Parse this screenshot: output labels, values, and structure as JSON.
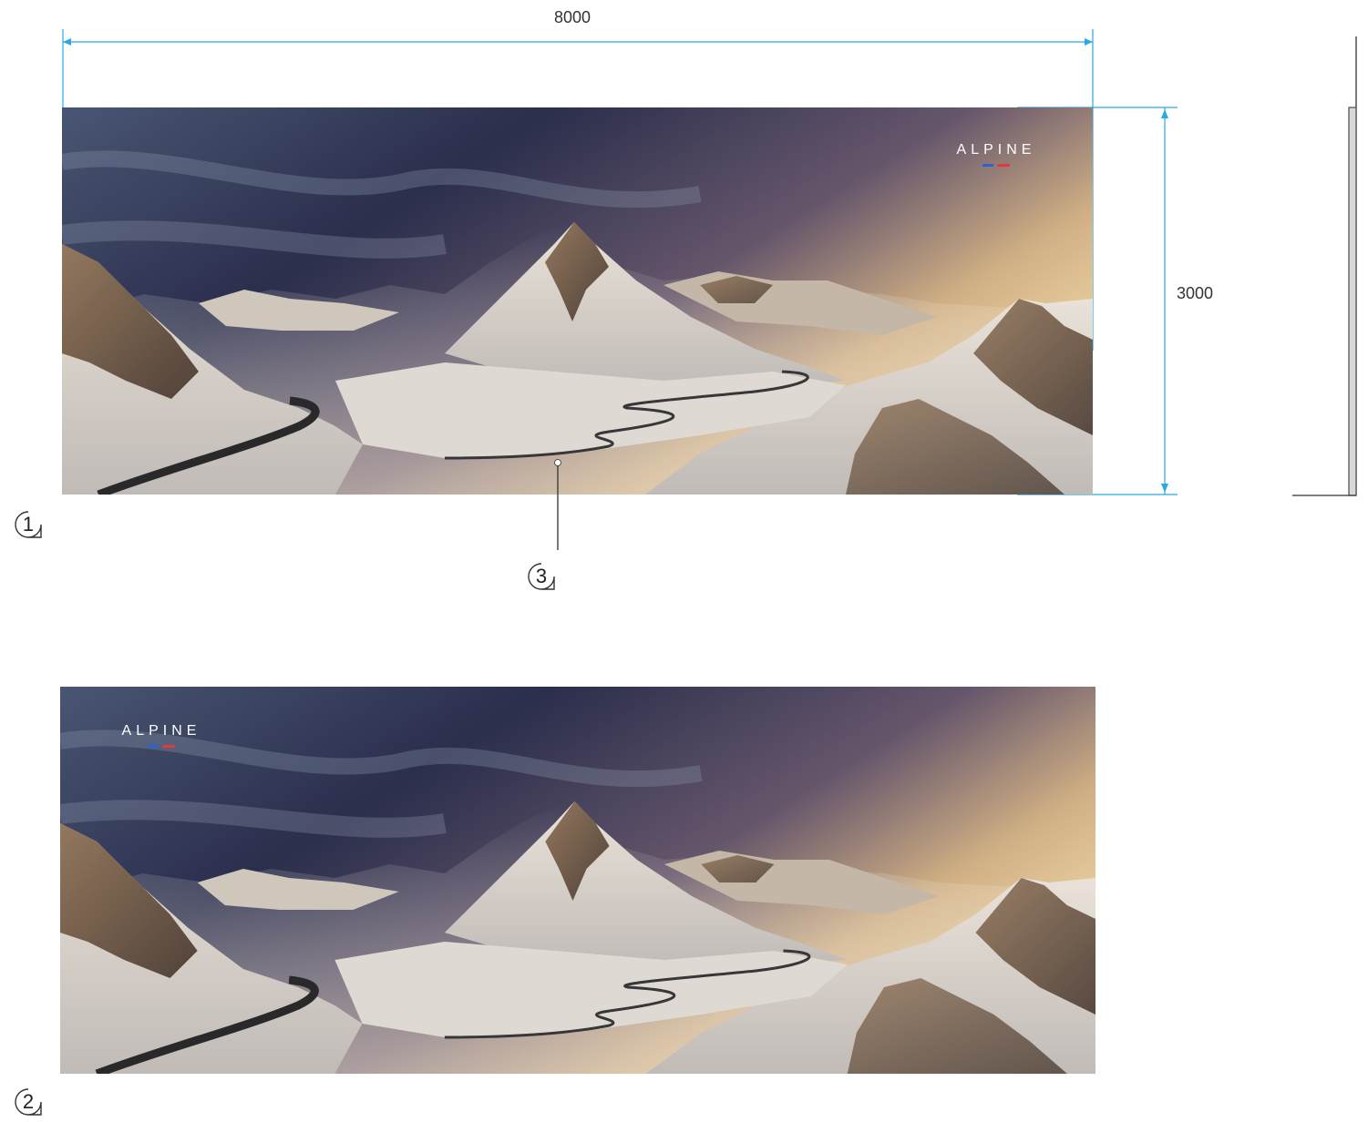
{
  "dimensions": {
    "width": "8000",
    "height": "3000"
  },
  "banners": [
    {
      "id": "1",
      "logo_text": "ALPINE"
    },
    {
      "id": "2",
      "logo_text": "ALPINE"
    }
  ],
  "callouts": {
    "banner_1": "1",
    "banner_2": "2",
    "print_material": "3"
  },
  "colors": {
    "dimension_line": "#29a9e0",
    "flag_blue": "#2f5fd0",
    "flag_red": "#e03b3b"
  }
}
